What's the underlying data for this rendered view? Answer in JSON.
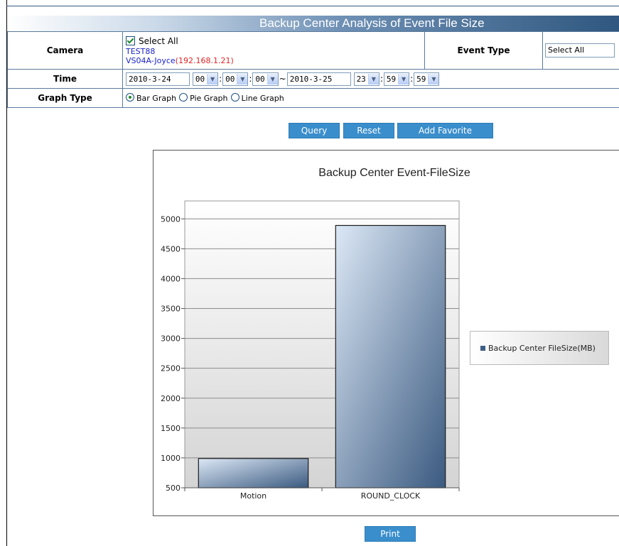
{
  "page": {
    "title": "Backup Center Analysis of Event File Size"
  },
  "form": {
    "camera_label": "Camera",
    "select_all_label": "Select All",
    "cameras": [
      {
        "name": "TEST88",
        "ip": ""
      },
      {
        "name": "VS04A-Joyce",
        "ip": "(192.168.1.21)"
      }
    ],
    "event_type_label": "Event Type",
    "event_type_value": "Select All",
    "time_label": "Time",
    "start_date": "2010-3-24",
    "start_hour": "00",
    "start_min": "00",
    "start_sec": "00",
    "tilde": "~",
    "end_date": "2010-3-25",
    "end_hour": "23",
    "end_min": "59",
    "end_sec": "59",
    "graph_type_label": "Graph Type",
    "graph_options": [
      {
        "label": "Bar Graph",
        "selected": true
      },
      {
        "label": "Pie Graph",
        "selected": false
      },
      {
        "label": "Line Graph",
        "selected": false
      }
    ]
  },
  "buttons": {
    "query": "Query",
    "reset": "Reset",
    "add_favorite": "Add Favorite",
    "print": "Print"
  },
  "chart_data": {
    "type": "bar",
    "title": "Backup Center Event-FileSize",
    "categories": [
      "Motion",
      "ROUND_CLOCK"
    ],
    "series": [
      {
        "name": "Backup Center FileSize(MB)",
        "values": [
          990,
          4890
        ]
      }
    ],
    "yticks": [
      500,
      1000,
      1500,
      2000,
      2500,
      3000,
      3500,
      4000,
      4500,
      5000
    ],
    "ylim": [
      500,
      5300
    ],
    "xlabel": "",
    "ylabel": "",
    "grid": true,
    "legend_position": "right",
    "bar_colors": [
      "#dce8f6",
      "#3b5a80"
    ]
  }
}
